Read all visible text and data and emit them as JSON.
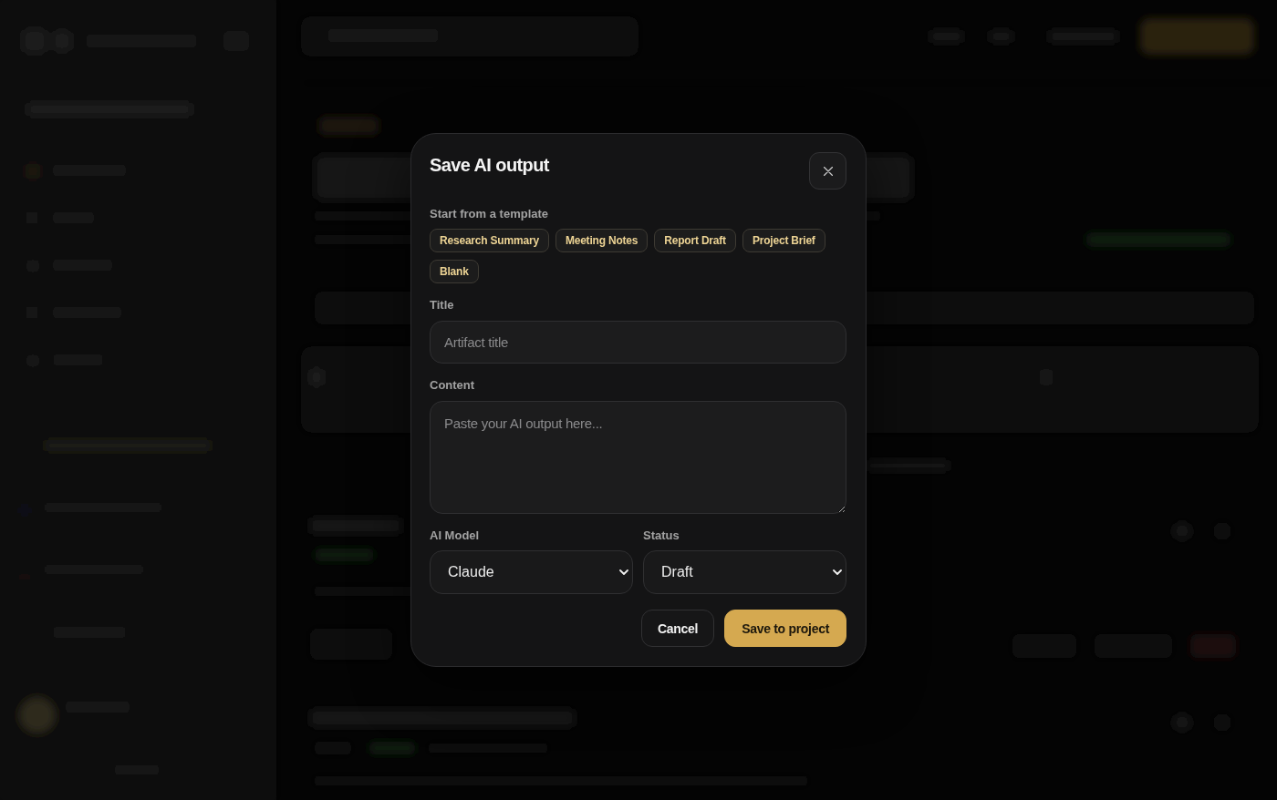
{
  "dialog": {
    "title": "Save AI output"
  },
  "template_section": {
    "label": "Start from a template",
    "templates": [
      "Research Summary",
      "Meeting Notes",
      "Report Draft",
      "Project Brief",
      "Blank"
    ]
  },
  "fields": [
    {
      "kind": "input",
      "label": "Title",
      "placeholder": "Artifact title"
    },
    {
      "kind": "textarea",
      "label": "Content",
      "placeholder": "Paste your AI output here..."
    }
  ],
  "selects": [
    {
      "label": "AI Model",
      "value": "Claude"
    },
    {
      "label": "Status",
      "value": "Draft"
    }
  ],
  "buttons": [
    {
      "kind": "secondary",
      "label": "Cancel"
    },
    {
      "kind": "primary",
      "label": "Save to project"
    }
  ]
}
